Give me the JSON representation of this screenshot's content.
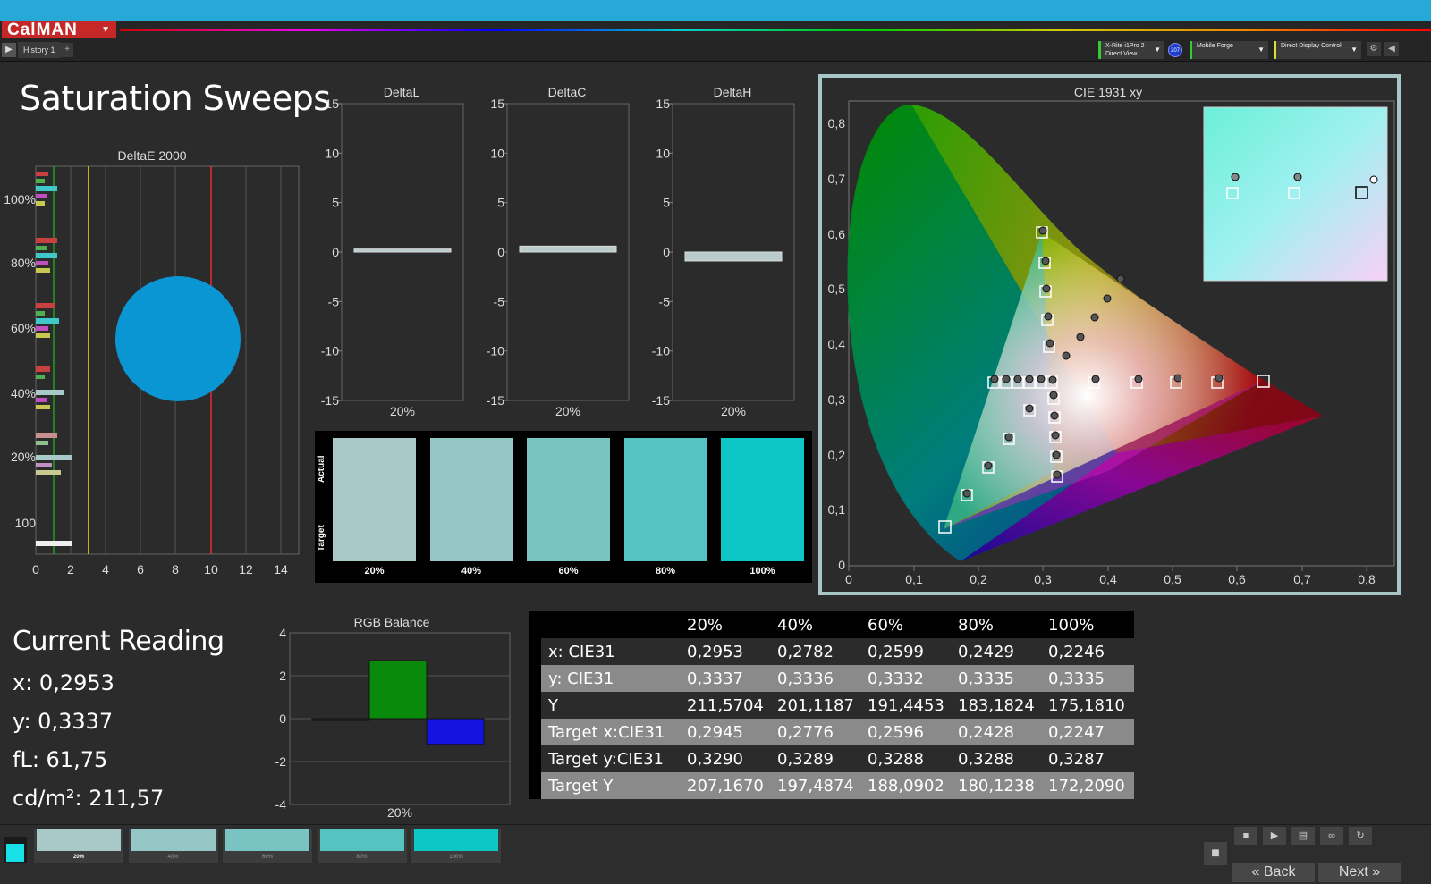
{
  "app": {
    "logo": "CalMAN",
    "tab_label": "History 1",
    "devices": [
      {
        "line1": "X-Rite i1Pro 2",
        "line2": "Direct View"
      },
      {
        "line1": "Mobile Forge",
        "line2": ""
      },
      {
        "line1": "Direct Display Control",
        "line2": ""
      }
    ],
    "badge": "207"
  },
  "page_title": "Saturation Sweeps",
  "colors": {
    "accent": "#27a9d8",
    "logo": "#c62828",
    "target_swatch": "#00c8c8"
  },
  "deltae": {
    "title": "DeltaE 2000",
    "y_labels": [
      "100%",
      "80%",
      "60%",
      "40%",
      "20%",
      "100"
    ],
    "x_ticks": [
      "0",
      "2",
      "4",
      "6",
      "8",
      "10",
      "12",
      "14"
    ]
  },
  "deltas": [
    {
      "title": "DeltaL",
      "xlabel": "20%",
      "value": 0.3
    },
    {
      "title": "DeltaC",
      "xlabel": "20%",
      "value": 0.6
    },
    {
      "title": "DeltaH",
      "xlabel": "20%",
      "value": -0.9
    }
  ],
  "delta_y_ticks": [
    "15",
    "10",
    "5",
    "0",
    "-5",
    "-10",
    "-15"
  ],
  "swatches": {
    "actual_label": "Actual",
    "target_label": "Target",
    "items": [
      {
        "label": "20%",
        "color": "#a8c9c8"
      },
      {
        "label": "40%",
        "color": "#93c6c5"
      },
      {
        "label": "60%",
        "color": "#79c3c2"
      },
      {
        "label": "80%",
        "color": "#55c3c2"
      },
      {
        "label": "100%",
        "color": "#0fc6c6"
      }
    ]
  },
  "cie": {
    "title": "CIE 1931 xy",
    "x_ticks": [
      "0",
      "0,1",
      "0,2",
      "0,3",
      "0,4",
      "0,5",
      "0,6",
      "0,7",
      "0,8"
    ],
    "y_ticks": [
      "0",
      "0,1",
      "0,2",
      "0,3",
      "0,4",
      "0,5",
      "0,6",
      "0,7",
      "0,8"
    ]
  },
  "reading": {
    "title": "Current Reading",
    "x": "x: 0,2953",
    "y": "y: 0,3337",
    "fl": "fL: 61,75",
    "cdm2": "cd/m²: 211,57"
  },
  "rgb_balance": {
    "title": "RGB Balance",
    "xlabel": "20%",
    "y_ticks": [
      "4",
      "2",
      "0",
      "-2",
      "-4"
    ]
  },
  "chart_data": [
    {
      "type": "bar",
      "title": "RGB Balance",
      "categories": [
        "20%"
      ],
      "series": [
        {
          "name": "Red",
          "color": "#222222",
          "values": [
            -0.05
          ]
        },
        {
          "name": "Green",
          "color": "#0a8a0a",
          "values": [
            2.7
          ]
        },
        {
          "name": "Blue",
          "color": "#1414e0",
          "values": [
            -1.2
          ]
        }
      ],
      "ylim": [
        -4,
        4
      ]
    }
  ],
  "table": {
    "columns": [
      "",
      "20%",
      "40%",
      "60%",
      "80%",
      "100%"
    ],
    "rows": [
      [
        "x: CIE31",
        "0,2953",
        "0,2782",
        "0,2599",
        "0,2429",
        "0,2246"
      ],
      [
        "y: CIE31",
        "0,3337",
        "0,3336",
        "0,3332",
        "0,3335",
        "0,3335"
      ],
      [
        "Y",
        "211,5704",
        "201,1187",
        "191,4453",
        "183,1824",
        "175,1810"
      ],
      [
        "Target x:CIE31",
        "0,2945",
        "0,2776",
        "0,2596",
        "0,2428",
        "0,2247"
      ],
      [
        "Target y:CIE31",
        "0,3290",
        "0,3289",
        "0,3288",
        "0,3288",
        "0,3287"
      ],
      [
        "Target Y",
        "207,1670",
        "197,4874",
        "188,0902",
        "180,1238",
        "172,2090"
      ]
    ]
  },
  "bottom": {
    "swatches": [
      {
        "label": "20%",
        "color": "#a8c9c8"
      },
      {
        "label": "40%",
        "color": "#93c6c5"
      },
      {
        "label": "60%",
        "color": "#79c3c2"
      },
      {
        "label": "80%",
        "color": "#55c3c2"
      },
      {
        "label": "100%",
        "color": "#0fc6c6"
      }
    ],
    "back": "Back",
    "next": "Next"
  }
}
